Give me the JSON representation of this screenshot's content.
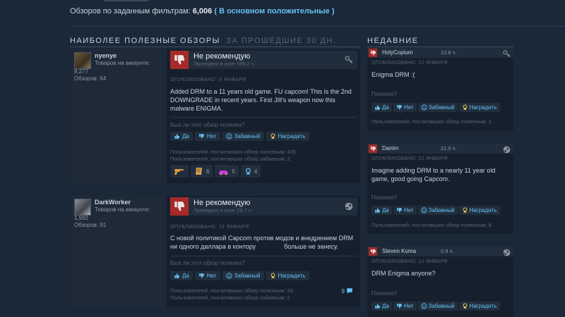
{
  "summary": {
    "prefix": "Обзоров по заданным фильтрам:",
    "count": "6,006",
    "open": "(",
    "rating": "В основном положительные",
    "close": ")"
  },
  "helpful_section": {
    "title": "НАИБОЛЕЕ ПОЛЕЗНЫЕ ОБЗОРЫ",
    "subtitle": "ЗА ПРОШЕДШИЕ 30 ДН."
  },
  "recent_section": {
    "title": "НЕДАВНИЕ"
  },
  "colors": {
    "background": "#1b2838",
    "negative": "#a72a2a",
    "link": "#67c1f5",
    "rating": "#66c0f4"
  },
  "buttons": {
    "helpful_question": "Был ли этот обзор полезен?",
    "yes": "Да",
    "no": "Нет",
    "funny": "Забавный",
    "award": "Наградить",
    "helpful_question_short": "Полезно?"
  },
  "reviews": [
    {
      "author": {
        "name": "nyenye",
        "products_label": "Товаров на аккаунте:",
        "products": "8,277",
        "reviews": "Обзоров: 64"
      },
      "verdict": "Не рекомендую",
      "hours": "Проведено в игре: 589.2 ч.",
      "posted": "ОПУБЛИКОВАНО: 9 ЯНВАРЯ",
      "text": "Added DRM to a 11 years old game. FU capcom! This is the 2nd DOWNGRADE in recent years. First JIll's weapon now this malware ENIGMA.",
      "helpful_stat": "Пользователей, посчитавших обзор полезным: 435",
      "funny_stat": "Пользователей, посчитавших обзор забавным: 2",
      "corner_icon": "key-icon",
      "awards": [
        {
          "icon": "gun-award-icon",
          "count": ""
        },
        {
          "icon": "scroll-award-icon",
          "count": "6"
        },
        {
          "icon": "car-award-icon",
          "count": "5"
        },
        {
          "icon": "medal-award-icon",
          "count": "4"
        }
      ]
    },
    {
      "author": {
        "name": "DarkWorker",
        "products_label": "Товаров на аккаунте:",
        "products": "1,992",
        "reviews": "Обзоров: 91"
      },
      "verdict": "Не рекомендую",
      "hours": "Проведено в игре: 28.7 ч.",
      "posted": "ОПУБЛИКОВАНО: 11 ЯНВАРЯ",
      "text_line1": "С новой политикой Capcom против модов и внедрением DRM",
      "text_line2a": "ни одного даллара в контору",
      "text_line2b": "больше не занесу.",
      "helpful_stat": "Пользователей, посчитавших обзор полезным: 26",
      "funny_stat": "Пользователей, посчитавших обзор забавным: 2",
      "corner_icon": "steam-icon",
      "comments": "9"
    }
  ],
  "recent": [
    {
      "name": "HolyCopium",
      "hours": "13.8 ч.",
      "posted": "ОПУБЛИКОВАНО: 12 ЯНВАРЯ",
      "text": "Enigma DRM :(",
      "stat": "Пользователей, посчитавших обзор полезным: 3",
      "icon": "key-icon"
    },
    {
      "name": "Danim",
      "hours": "21.0 ч.",
      "posted": "ОПУБЛИКОВАНО: 12 ЯНВАРЯ",
      "text": "Imagine adding DRM to a nearly 11 year old game, good going Capcom.",
      "stat": "Пользователей, посчитавших обзор полезным: 6",
      "icon": "steam-icon"
    },
    {
      "name": "Steven Kuma",
      "hours": "0.9 ч.",
      "posted": "ОПУБЛИКОВАНО: 12 ЯНВАРЯ",
      "text": "DRM Enigma anyone?",
      "icon": "steam-icon"
    }
  ]
}
